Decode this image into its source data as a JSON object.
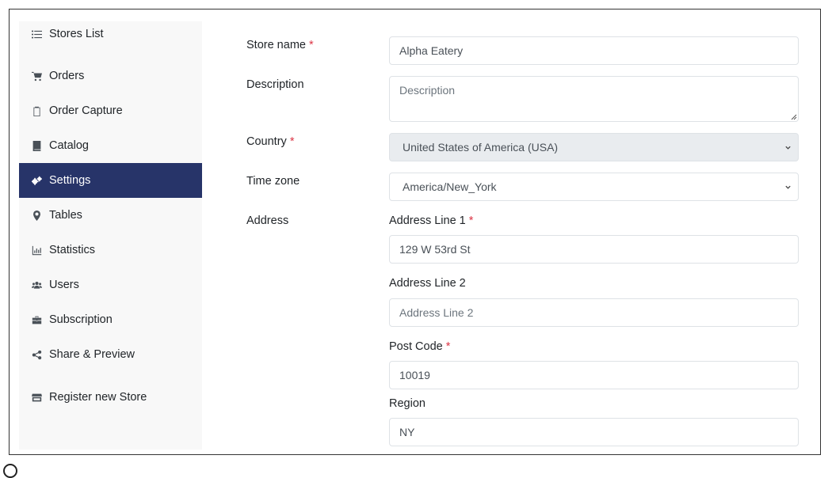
{
  "sidebar": {
    "items": [
      {
        "label": "Stores List",
        "icon": "list-icon"
      },
      {
        "label": "Orders",
        "icon": "cart-icon"
      },
      {
        "label": "Order Capture",
        "icon": "clipboard-icon"
      },
      {
        "label": "Catalog",
        "icon": "book-icon"
      },
      {
        "label": "Settings",
        "icon": "cogs-icon",
        "active": true
      },
      {
        "label": "Tables",
        "icon": "map-marker-icon"
      },
      {
        "label": "Statistics",
        "icon": "bar-chart-icon"
      },
      {
        "label": "Users",
        "icon": "users-icon"
      },
      {
        "label": "Subscription",
        "icon": "briefcase-icon"
      },
      {
        "label": "Share & Preview",
        "icon": "share-icon"
      },
      {
        "label": "Register new Store",
        "icon": "store-icon"
      }
    ],
    "active_color": "#273469"
  },
  "form": {
    "store_name": {
      "label": "Store name",
      "required": "*",
      "value": "Alpha Eatery"
    },
    "description": {
      "label": "Description",
      "placeholder": "Description",
      "value": ""
    },
    "country": {
      "label": "Country",
      "required": "*",
      "value": "United States of America (USA)"
    },
    "timezone": {
      "label": "Time zone",
      "value": "America/New_York"
    },
    "address": {
      "label": "Address",
      "line1": {
        "label": "Address Line 1",
        "required": "*",
        "value": "129 W 53rd St"
      },
      "line2": {
        "label": "Address Line 2",
        "placeholder": "Address Line 2",
        "value": ""
      },
      "post_code": {
        "label": "Post Code",
        "required": "*",
        "value": "10019"
      },
      "region": {
        "label": "Region",
        "value": "NY"
      }
    }
  }
}
